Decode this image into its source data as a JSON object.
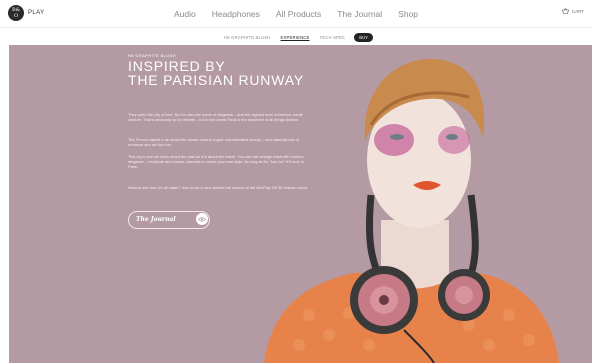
{
  "brand": {
    "logo_top": "B&",
    "logo_bottom": "O",
    "logo_play": "PLAY"
  },
  "nav": {
    "items": [
      "Audio",
      "Headphones",
      "All Products",
      "The Journal",
      "Shop"
    ]
  },
  "cart": {
    "label": "CART"
  },
  "subnav": {
    "items": [
      "H6 GRAPHITE BLUSH",
      "EXPERIENCE",
      "TECH SPEC"
    ],
    "active": "EXPERIENCE",
    "buy_label": "BUY"
  },
  "hero": {
    "eyebrow": "H6 GRAPHITE BLUSH",
    "headline_line1": "INSPIRED BY",
    "headline_line2": "THE PARISIAN RUNWAY",
    "p1": "They call it the city of love. But it's also the home of elegance – and the highest level of fashion: haute couture. That's obviously up for debate – but to the locals Paris is the epicentre of all things fashion.",
    "p2": "The French capital is all about the classic colony vogue: sophisticated beauty – and naturally lots of romance and red lips too.",
    "p3": "This city is just as much about the past as it is about the future. You can mix vintage retail with modern elegance – chutzpah and classic, assured to create your own style. As long as it's \"bon ton\" it'll work in Paris.",
    "p4": "Want to see how it's all made? Join us for a view behind the scenes of the BeoPlay H6 SE fashion shoot.",
    "journal_label": "The Journal"
  },
  "colors": {
    "hero_bg": "#b49aa3",
    "accent_orange": "#e7834a",
    "nav_text": "#8a8a8a"
  },
  "icons": {
    "cart": "basket-icon",
    "journal": "eye-icon"
  }
}
